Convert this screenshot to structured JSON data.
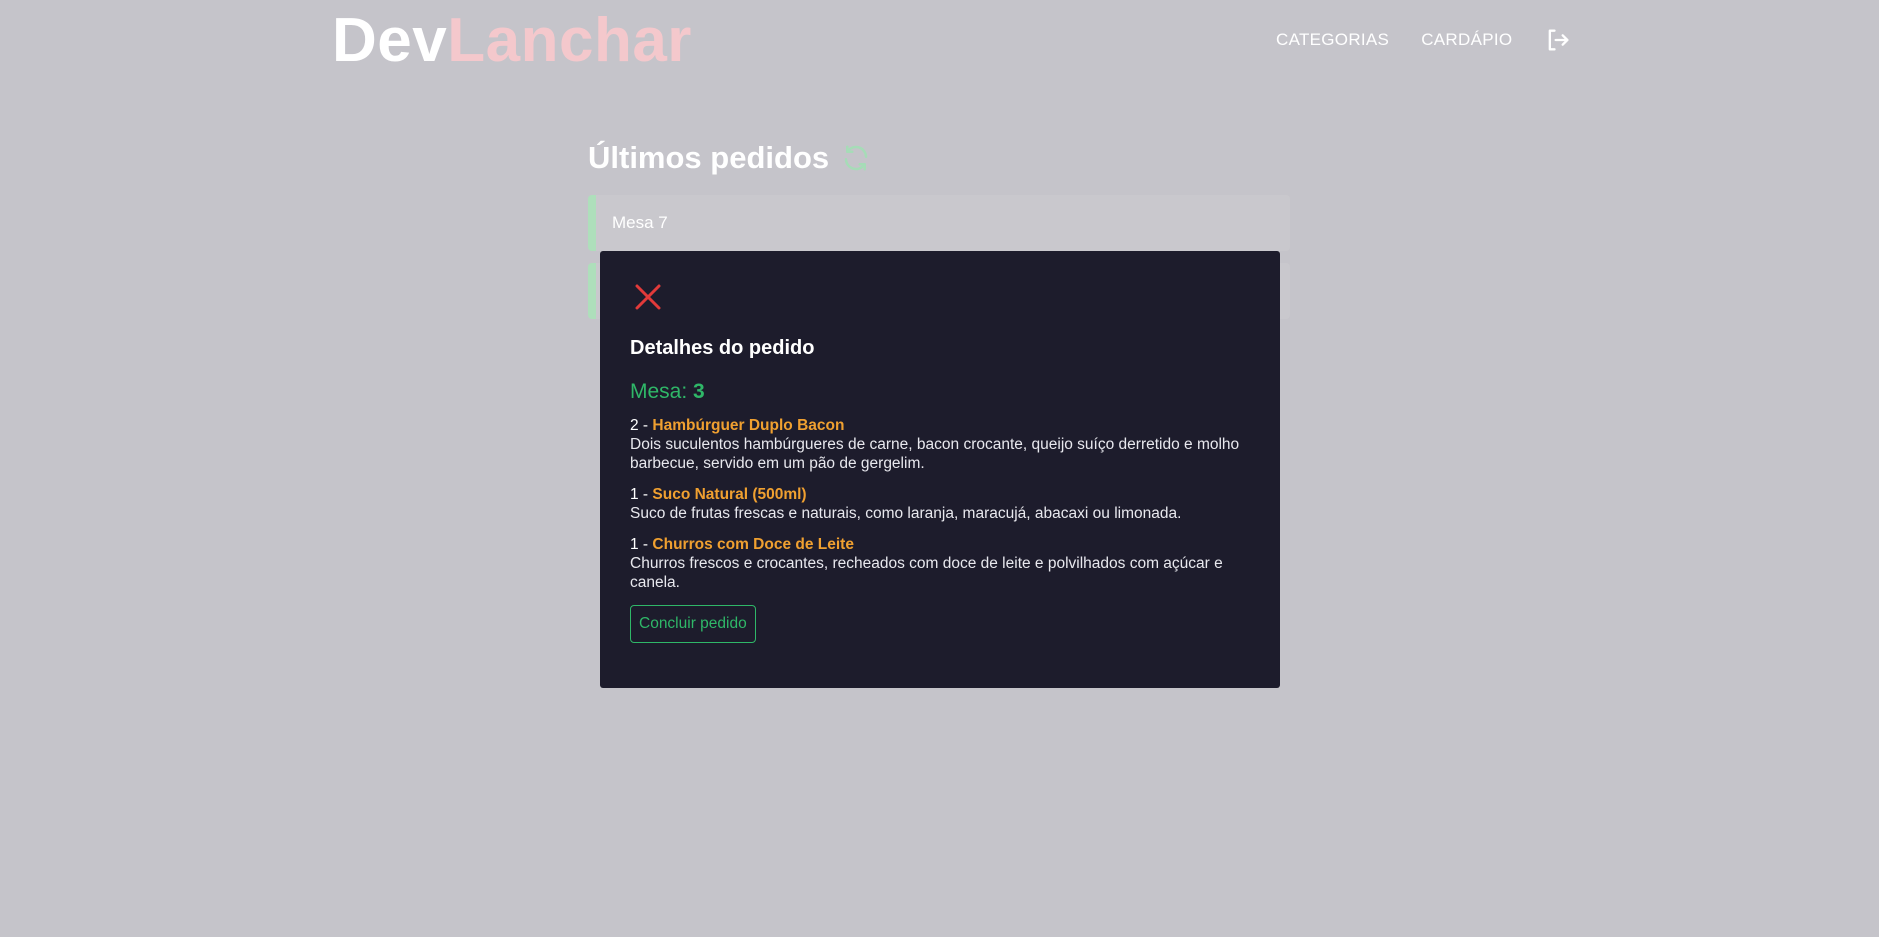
{
  "header": {
    "logo_part1": "Dev",
    "logo_part2": "Lanchar",
    "nav": {
      "categories_label": "CATEGORIAS",
      "menu_label": "CARDÁPIO"
    },
    "logout_icon": "logout-icon"
  },
  "orders": {
    "title": "Últimos pedidos",
    "refresh_icon": "refresh-icon",
    "items": [
      {
        "label": "Mesa 7"
      },
      {
        "label": ""
      }
    ]
  },
  "modal": {
    "close_icon": "close-icon",
    "title": "Detalhes do pedido",
    "table_label": "Mesa:",
    "table_number": "3",
    "items": [
      {
        "qty": "2 -",
        "name": "Hambúrguer Duplo Bacon",
        "description": "Dois suculentos hambúrgueres de carne, bacon crocante, queijo suíço derretido e molho barbecue, servido em um pão de gergelim."
      },
      {
        "qty": "1 -",
        "name": "Suco Natural (500ml)",
        "description": "Suco de frutas frescas e naturais, como laranja, maracujá, abacaxi ou limonada."
      },
      {
        "qty": "1 -",
        "name": "Churros com Doce de Leite",
        "description": "Churros frescos e crocantes, recheados com doce de leite e polvilhados com açúcar e canela."
      }
    ],
    "finish_button_label": "Concluir pedido"
  },
  "colors": {
    "background": "#c5c4ca",
    "modal_background": "#1d1c2c",
    "accent_green": "#2fb768",
    "item_orange": "#f0a030",
    "logo_pink": "#f4c8cc",
    "close_red": "#e23a3a"
  }
}
